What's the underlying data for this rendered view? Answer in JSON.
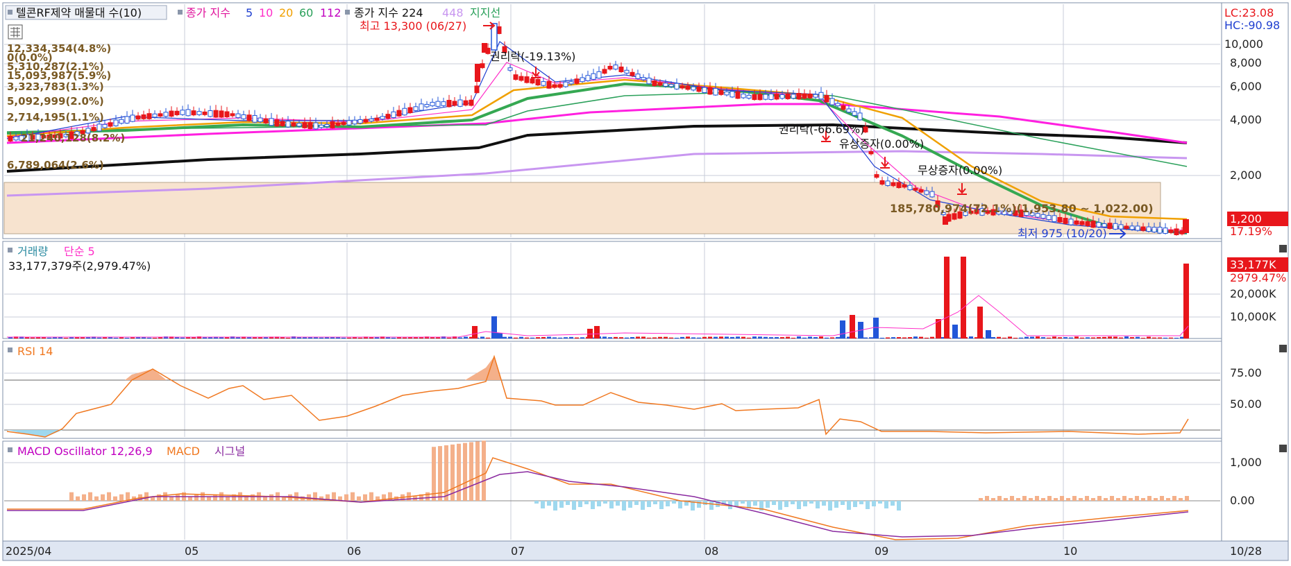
{
  "colors": {
    "up": "#e8161b",
    "down": "#2256d8",
    "ma5": "#1f3fd0",
    "ma10": "#ff2ec8",
    "ma20": "#f0a000",
    "ma60": "#2aa05a",
    "ma112": "#35a852",
    "ma224": "#101010",
    "ma448": "#c896f0",
    "envelope": "#ff20e0",
    "support_band": "#f7e3cf",
    "grid": "#c8ccd8",
    "axis_bg": "#dfe6f2"
  },
  "price_pane": {
    "title": "텔콘RF제약 매물대 수(10)",
    "legend_label": "종가 지수",
    "legend_periods": [
      "5",
      "10",
      "20",
      "60",
      "112"
    ],
    "legend_label2": "종가 지수 224",
    "legend_period_448": "448",
    "legend_support": "지지선",
    "lc": "LC:23.08",
    "hc": "HC:-90.98",
    "high_label": "최고 13,300 (06/27)",
    "low_label": "최저 975 (10/20)",
    "current_price": "1,200",
    "current_pct": "17.19%",
    "rights_1": "권리락(-19.13%)",
    "rights_2": "권리락(-66.69%)",
    "paid_increase": "유상증자(0.00%)",
    "bonus_issue": "무상증자(0.00%)",
    "band_summary": "185,780,974(72.1%)(1,953.80 ~ 1,022.00)",
    "volume_profile": [
      "12,334,354(4.8%)",
      "0(0.0%)",
      "5,310,287(2.1%)",
      "15,093,987(5.9%)",
      "3,323,783(1.3%)",
      "5,092,999(2.0%)",
      "2,714,195(1.1%)",
      "21,240,128(8.2%)",
      "6,789,064(2.6%)"
    ],
    "y_ticks": [
      "10,000",
      "8,000",
      "6,000",
      "4,000",
      "2,000"
    ]
  },
  "volume_pane": {
    "title": "거래량",
    "ma_label": "단순 5",
    "value_text": "33,177,379주(2,979.47%)",
    "badge": "33,177K",
    "badge_pct": "2979.47%",
    "y_ticks": [
      "20,000K",
      "10,000K"
    ]
  },
  "rsi_pane": {
    "title": "RSI 14",
    "y_ticks": [
      "75.00",
      "50.00"
    ]
  },
  "macd_pane": {
    "title_osc": "MACD Oscillator 12,26,9",
    "title_macd": "MACD",
    "title_signal": "시그널",
    "y_ticks": [
      "1,000",
      "0.00"
    ]
  },
  "x_axis": {
    "labels": [
      "2025/04",
      "05",
      "06",
      "07",
      "08",
      "09",
      "10",
      "10/28"
    ]
  },
  "chart_data": {
    "type": "candlestick",
    "title": "텔콘RF제약",
    "x_labels": [
      "2025/04",
      "05",
      "06",
      "07",
      "08",
      "09",
      "10",
      "10/28"
    ],
    "price_scale": "log",
    "price_ticks": [
      10000,
      8000,
      6000,
      4000,
      2000
    ],
    "high": {
      "value": 13300,
      "date": "06/27"
    },
    "low": {
      "value": 975,
      "date": "10/20"
    },
    "current": {
      "value": 1200,
      "change_pct": 17.19
    },
    "close_path": [
      {
        "x": "2025/04",
        "y": 3000
      },
      {
        "x": "05",
        "y": 4300
      },
      {
        "x": "06",
        "y": 3600
      },
      {
        "x": "06/27",
        "y": 11000
      },
      {
        "x": "07",
        "y": 6500
      },
      {
        "x": "08",
        "y": 5500
      },
      {
        "x": "09",
        "y": 1800
      },
      {
        "x": "10",
        "y": 1100
      },
      {
        "x": "10/28",
        "y": 1200
      }
    ],
    "volume_last": {
      "value": 33177379,
      "pct": 2979.47
    },
    "rsi_period": 14,
    "macd_params": [
      12,
      26,
      9
    ]
  }
}
